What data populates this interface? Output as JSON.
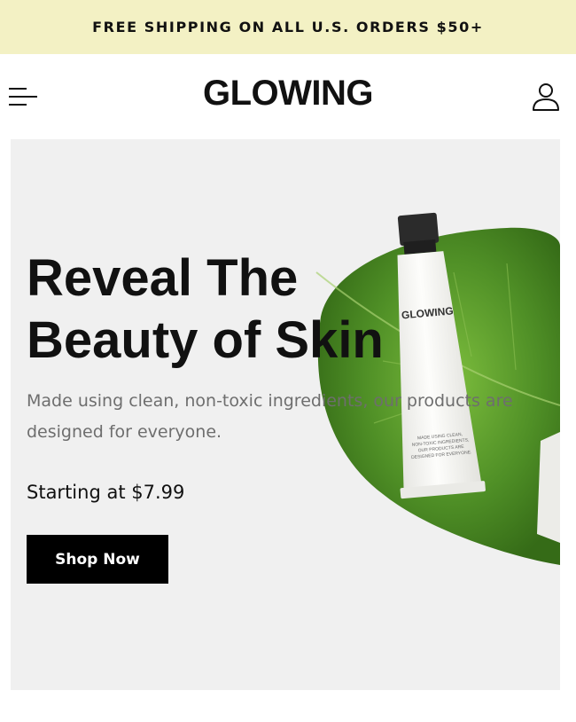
{
  "announcement": {
    "text": "FREE SHIPPING ON ALL U.S. ORDERS $50+"
  },
  "header": {
    "logo": "GLOWING",
    "menu_icon": "hamburger-menu-icon",
    "account_icon": "user-account-icon"
  },
  "hero": {
    "title_line1": "Reveal The",
    "title_line2": "Beauty of Skin",
    "description": "Made using clean, non-toxic ingredients, our products are designed for everyone.",
    "price_text": "Starting at $7.99",
    "cta_label": "Shop Now",
    "product_brand": "GLOWING",
    "product_text": [
      "MADE USING CLEAN,",
      "NON-TOXIC INGREDIENTS,",
      "OUR PRODUCTS ARE",
      "DESIGNED FOR EVERYONE."
    ]
  },
  "colors": {
    "announcement_bg": "#f3f1c4",
    "hero_bg": "#f0f0f0",
    "leaf": "#5a9a2c",
    "cta_bg": "#000000"
  }
}
